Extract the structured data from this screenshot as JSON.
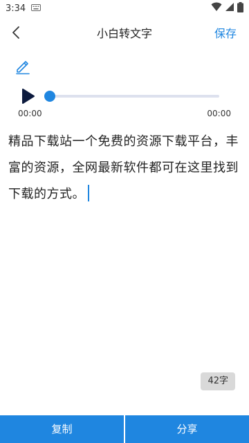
{
  "status_bar": {
    "time": "3:34",
    "icons": [
      "keyboard-icon",
      "wifi-icon",
      "signal-icon",
      "battery-icon"
    ]
  },
  "header": {
    "title": "小白转文字",
    "save_label": "保存",
    "back_icon": "chevron-left-icon"
  },
  "toolbar": {
    "edit_icon": "pencil-icon"
  },
  "player": {
    "current_time": "00:00",
    "total_time": "00:00",
    "progress": 0,
    "play_icon": "play-icon"
  },
  "content": {
    "text": "精品下载站一个免费的资源下载平台，丰富的资源，全网最新软件都可在这里找到下载的方式。"
  },
  "word_count": "42字",
  "bottom_bar": {
    "copy_label": "复制",
    "share_label": "分享"
  },
  "colors": {
    "accent": "#1f86e0",
    "track": "#dde1ee",
    "play_icon": "#0d1b3e",
    "badge_bg": "#d9d9d9"
  }
}
